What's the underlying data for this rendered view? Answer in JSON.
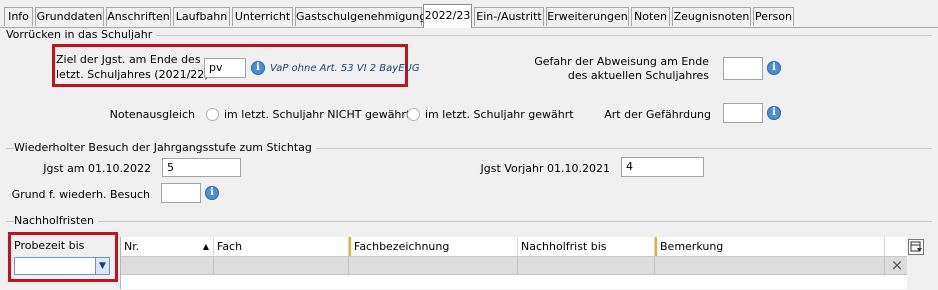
{
  "tabs": [
    {
      "label": "Info"
    },
    {
      "label": "Grunddaten"
    },
    {
      "label": "Anschriften"
    },
    {
      "label": "Laufbahn"
    },
    {
      "label": "Unterricht"
    },
    {
      "label": "Gastschulgenehmigung"
    },
    {
      "label": "2022/23"
    },
    {
      "label": "Ein-/Austritt"
    },
    {
      "label": "Erweiterungen"
    },
    {
      "label": "Noten"
    },
    {
      "label": "Zeugnisnoten"
    },
    {
      "label": "Person"
    }
  ],
  "active_tab": "2022/23",
  "vorruecken": {
    "legend": "Vorrücken in das Schuljahr",
    "ziel_label_line1": "Ziel der Jgst. am Ende des",
    "ziel_label_line2": "letzt. Schuljahres (2021/22)",
    "ziel_value": "pv",
    "ziel_note": "VaP ohne Art. 53 VI 2 BayEUG",
    "gefahr_label_line1": "Gefahr der Abweisung am Ende",
    "gefahr_label_line2": "des aktuellen Schuljahres",
    "gefahr_value": "",
    "notenausgleich_label": "Notenausgleich",
    "radio_nicht": "im letzt. Schuljahr NICHT gewährt",
    "radio_gewaehrt": "im letzt. Schuljahr gewährt",
    "art_label": "Art der Gefährdung",
    "art_value": ""
  },
  "wiederholt": {
    "legend": "Wiederholter Besuch der Jahrgangsstufe zum Stichtag",
    "jgst_label": "Jgst am 01.10.2022",
    "jgst_value": "5",
    "vorjahr_label": "Jgst Vorjahr 01.10.2021",
    "vorjahr_value": "4",
    "grund_label": "Grund f. wiederh. Besuch",
    "grund_value": ""
  },
  "nachholfristen": {
    "legend": "Nachholfristen",
    "probezeit_label": "Probezeit bis",
    "probezeit_value": "",
    "columns": [
      "Nr.",
      "Fach",
      "Fachbezeichnung",
      "Nachholfrist bis",
      "Bemerkung"
    ],
    "sort_indicator": "▲",
    "delete_icon": "×"
  },
  "colors": {
    "highlight": "#c1121f",
    "info_icon": "#4d8ed0",
    "column_marker": "#f5a623"
  }
}
